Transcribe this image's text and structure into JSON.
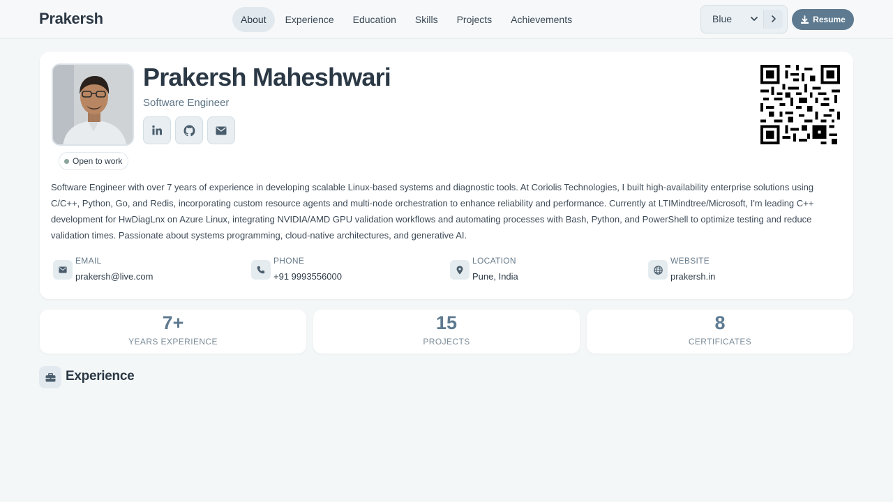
{
  "header": {
    "brand": "Prakersh",
    "nav": [
      {
        "label": "About",
        "active": true
      },
      {
        "label": "Experience",
        "active": false
      },
      {
        "label": "Education",
        "active": false
      },
      {
        "label": "Skills",
        "active": false
      },
      {
        "label": "Projects",
        "active": false
      },
      {
        "label": "Achievements",
        "active": false
      }
    ],
    "theme_select": {
      "value": "Blue"
    },
    "resume_label": "Resume"
  },
  "profile": {
    "name": "Prakersh Maheshwari",
    "role": "Software Engineer",
    "status": "Open to work",
    "social": [
      {
        "icon": "linkedin-icon"
      },
      {
        "icon": "github-icon"
      },
      {
        "icon": "mail-icon"
      }
    ],
    "summary": "Software Engineer with over 7 years of experience in developing scalable Linux-based systems and diagnostic tools. At Coriolis Technologies, I built high-availability enterprise solutions using C/C++, Python, Go, and Redis, incorporating custom resource agents and multi-node orchestration to enhance reliability and performance. Currently at LTIMindtree/Microsoft, I'm leading C++ development for HwDiagLnx on Azure Linux, integrating NVIDIA/AMD GPU validation workflows and automating processes with Bash, Python, and PowerShell to optimize testing and reduce validation times. Passionate about systems programming, cloud-native architectures, and generative AI.",
    "contacts": [
      {
        "label": "EMAIL",
        "value": "prakersh@live.com",
        "icon": "mail-icon"
      },
      {
        "label": "PHONE",
        "value": "+91 9993556000",
        "icon": "phone-icon"
      },
      {
        "label": "LOCATION",
        "value": "Pune, India",
        "icon": "location-pin-icon"
      },
      {
        "label": "WEBSITE",
        "value": "prakersh.in",
        "icon": "globe-icon"
      }
    ]
  },
  "stats": [
    {
      "value": "7+",
      "label": "YEARS EXPERIENCE"
    },
    {
      "value": "15",
      "label": "PROJECTS"
    },
    {
      "value": "8",
      "label": "CERTIFICATES"
    }
  ],
  "section": {
    "title": "Experience",
    "icon": "briefcase-icon"
  },
  "colors": {
    "accent": "#5e7a90",
    "background": "#f4f7f8",
    "status_dot": "#8aa59b"
  }
}
